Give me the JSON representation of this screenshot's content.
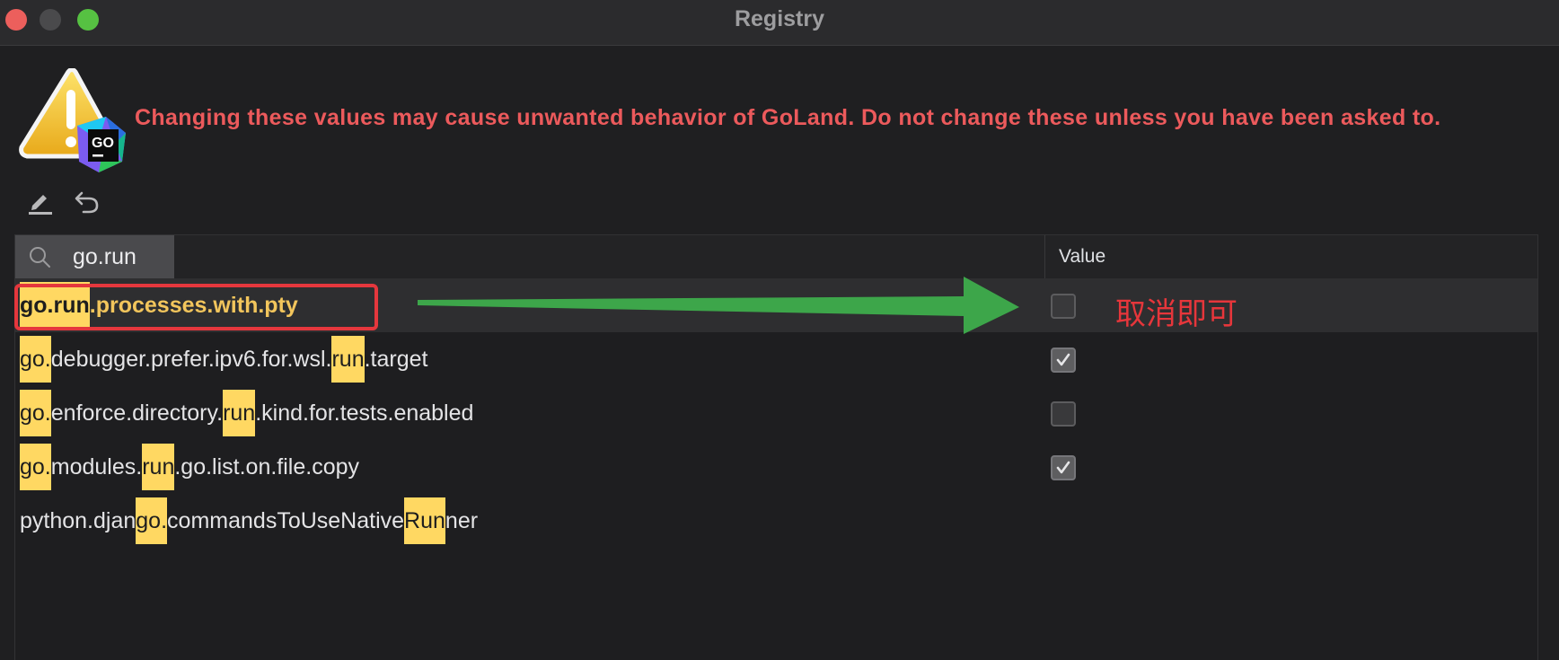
{
  "window": {
    "title": "Registry"
  },
  "warning": {
    "message": "Changing these values may cause unwanted behavior of GoLand. Do not change these unless you have been asked to.",
    "badge_text": "GO"
  },
  "toolbar": {
    "edit_icon": "pencil-icon",
    "revert_icon": "undo-icon"
  },
  "table": {
    "search_value": "go.run",
    "value_header": "Value",
    "rows": [
      {
        "segments": [
          {
            "text": "go.run",
            "hl": true
          },
          {
            "text": ".processes.with.pty",
            "hl": false
          }
        ],
        "checked": false,
        "selected": true
      },
      {
        "segments": [
          {
            "text": "go.",
            "hl": true
          },
          {
            "text": "debugger.prefer.ipv6.for.wsl.",
            "hl": false
          },
          {
            "text": "run",
            "hl": true
          },
          {
            "text": ".target",
            "hl": false
          }
        ],
        "checked": true,
        "selected": false
      },
      {
        "segments": [
          {
            "text": "go.",
            "hl": true
          },
          {
            "text": "enforce.directory.",
            "hl": false
          },
          {
            "text": "run",
            "hl": true
          },
          {
            "text": ".kind.for.tests.enabled",
            "hl": false
          }
        ],
        "checked": false,
        "selected": false
      },
      {
        "segments": [
          {
            "text": "go.",
            "hl": true
          },
          {
            "text": "modules.",
            "hl": false
          },
          {
            "text": "run",
            "hl": true
          },
          {
            "text": ".go.list.on.file.copy",
            "hl": false
          }
        ],
        "checked": true,
        "selected": false
      },
      {
        "segments": [
          {
            "text": "python.djan",
            "hl": false
          },
          {
            "text": "go.",
            "hl": true
          },
          {
            "text": "commandsToUseNative",
            "hl": false
          },
          {
            "text": "Run",
            "hl": true
          },
          {
            "text": "ner",
            "hl": false
          }
        ],
        "checked": null,
        "selected": false
      }
    ]
  },
  "annotation": {
    "text": "取消即可"
  },
  "colors": {
    "warning": "#ec5a5c",
    "highlight": "#ffd862",
    "annotation_red": "#e5373d",
    "arrow_green": "#3da64a"
  }
}
